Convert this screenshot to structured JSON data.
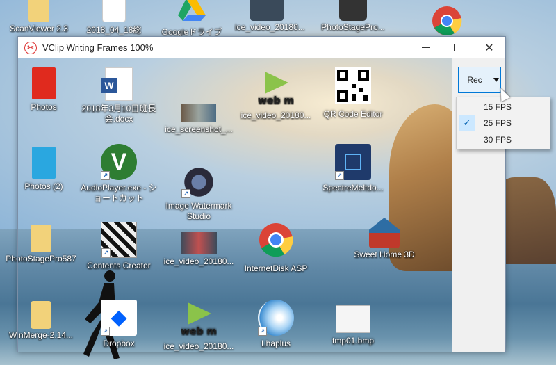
{
  "window": {
    "title": "VClip Writing Frames 100%",
    "rec_label": "Rec",
    "fps_menu": [
      {
        "label": "15 FPS",
        "checked": false
      },
      {
        "label": "25 FPS",
        "checked": true
      },
      {
        "label": "30 FPS",
        "checked": false
      }
    ]
  },
  "desktop_top": [
    {
      "label": "ScanViewer 2.3",
      "icon": "folder-icon"
    },
    {
      "label": "2018_04_18総会...",
      "icon": "document-icon"
    },
    {
      "label": "Googleドライブ",
      "icon": "google-drive-icon"
    },
    {
      "label": "ice_video_20180...",
      "icon": "video-icon"
    },
    {
      "label": "PhotoStagePro...",
      "icon": "camera-icon"
    },
    {
      "label": "chrome",
      "icon": "chrome-icon"
    }
  ],
  "desktop_left": [
    {
      "label": "PhotoStagePro587"
    },
    {
      "label": "WinMerge-2.14..."
    }
  ],
  "desktop_right": [
    {
      "label": "Sweet Home 3D"
    }
  ],
  "window_icons": [
    {
      "label": "Photos",
      "icon": "red-folder-icon"
    },
    {
      "label": "2018年3月10日班長会.docx",
      "icon": "word-document-icon"
    },
    {
      "label": "ice_screenshot_...",
      "icon": "screenshot-icon"
    },
    {
      "label": "ice_video_20180...",
      "icon": "webm-icon"
    },
    {
      "label": "QR Code Editor",
      "icon": "qr-code-icon"
    },
    {
      "label": "Photos (2)",
      "icon": "blue-folder-icon"
    },
    {
      "label": "AudioPlayer.exe - ショートカット",
      "icon": "v-player-icon"
    },
    {
      "label": "Image Watermark Studio",
      "icon": "watermark-camera-icon"
    },
    {
      "label": "SpectreMeltdo...",
      "icon": "chip-shield-icon"
    },
    {
      "label": "Contents Creator",
      "icon": "contents-creator-icon"
    },
    {
      "label": "ice_video_20180...",
      "icon": "video-thumb-icon"
    },
    {
      "label": "InternetDisk ASP",
      "icon": "chrome-icon"
    },
    {
      "label": "Dropbox",
      "icon": "dropbox-icon"
    },
    {
      "label": "ice_video_20180...",
      "icon": "webm-icon"
    },
    {
      "label": "Lhaplus",
      "icon": "lhaplus-icon"
    },
    {
      "label": "tmp01.bmp",
      "icon": "bmp-thumb-icon"
    }
  ]
}
